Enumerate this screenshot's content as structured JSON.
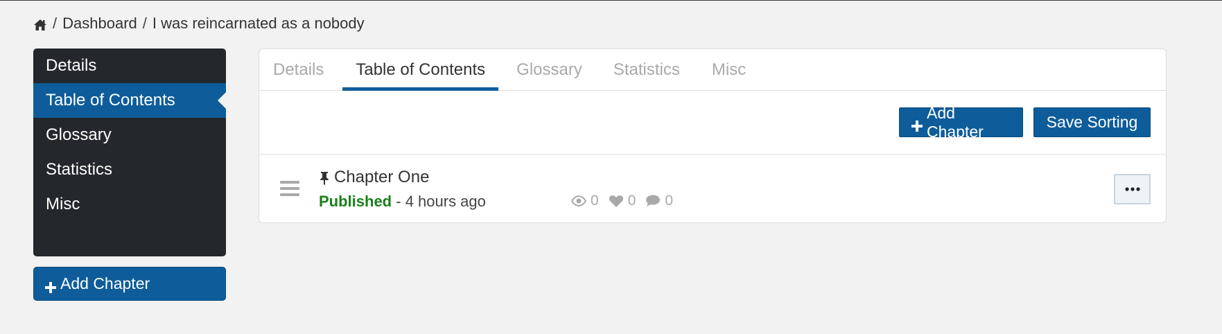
{
  "breadcrumb": {
    "home_icon": "home-icon",
    "separator": "/",
    "items": [
      "Dashboard",
      "I was reincarnated as a nobody"
    ]
  },
  "sidebar": {
    "items": [
      {
        "label": "Details",
        "active": false
      },
      {
        "label": "Table of Contents",
        "active": true
      },
      {
        "label": "Glossary",
        "active": false
      },
      {
        "label": "Statistics",
        "active": false
      },
      {
        "label": "Misc",
        "active": false
      }
    ],
    "add_button_label": "Add Chapter"
  },
  "tabs": [
    {
      "label": "Details",
      "active": false
    },
    {
      "label": "Table of Contents",
      "active": true
    },
    {
      "label": "Glossary",
      "active": false
    },
    {
      "label": "Statistics",
      "active": false
    },
    {
      "label": "Misc",
      "active": false
    }
  ],
  "toolbar": {
    "add_chapter_label": "Add Chapter",
    "save_sorting_label": "Save Sorting"
  },
  "chapters": [
    {
      "title": "Chapter One",
      "pinned": true,
      "status": "Published",
      "time_separator": " - ",
      "time": "4 hours ago",
      "views": "0",
      "likes": "0",
      "comments": "0"
    }
  ],
  "colors": {
    "primary": "#0e5d9a",
    "sidebar_bg": "#24272b",
    "published": "#1a7f1a",
    "page_bg": "#f2f2f2"
  }
}
